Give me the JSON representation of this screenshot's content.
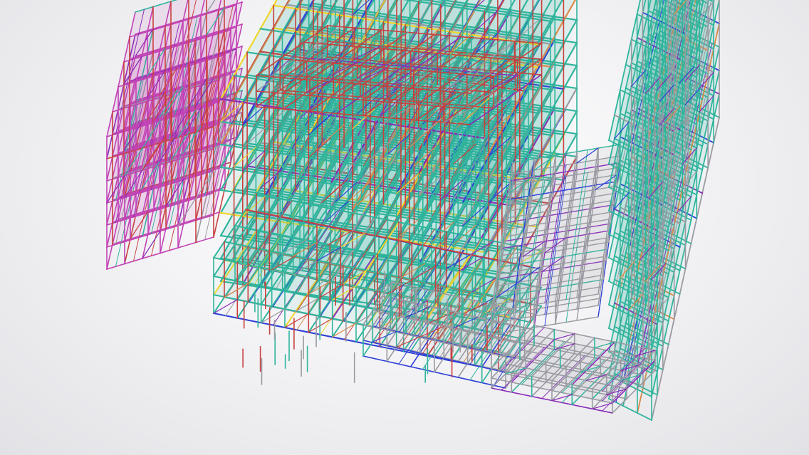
{
  "scene": {
    "description_hidden": "",
    "palette": {
      "teal": "#2fb59c",
      "teal_dark": "#1f8f7a",
      "red": "#c8413f",
      "orange": "#d98a4a",
      "purple": "#8a2bb8",
      "magenta": "#c243b5",
      "blue": "#2c3fd8",
      "yellow": "#f2d52a",
      "grey": "#9a9aa2",
      "background": "#eeeef1"
    }
  }
}
